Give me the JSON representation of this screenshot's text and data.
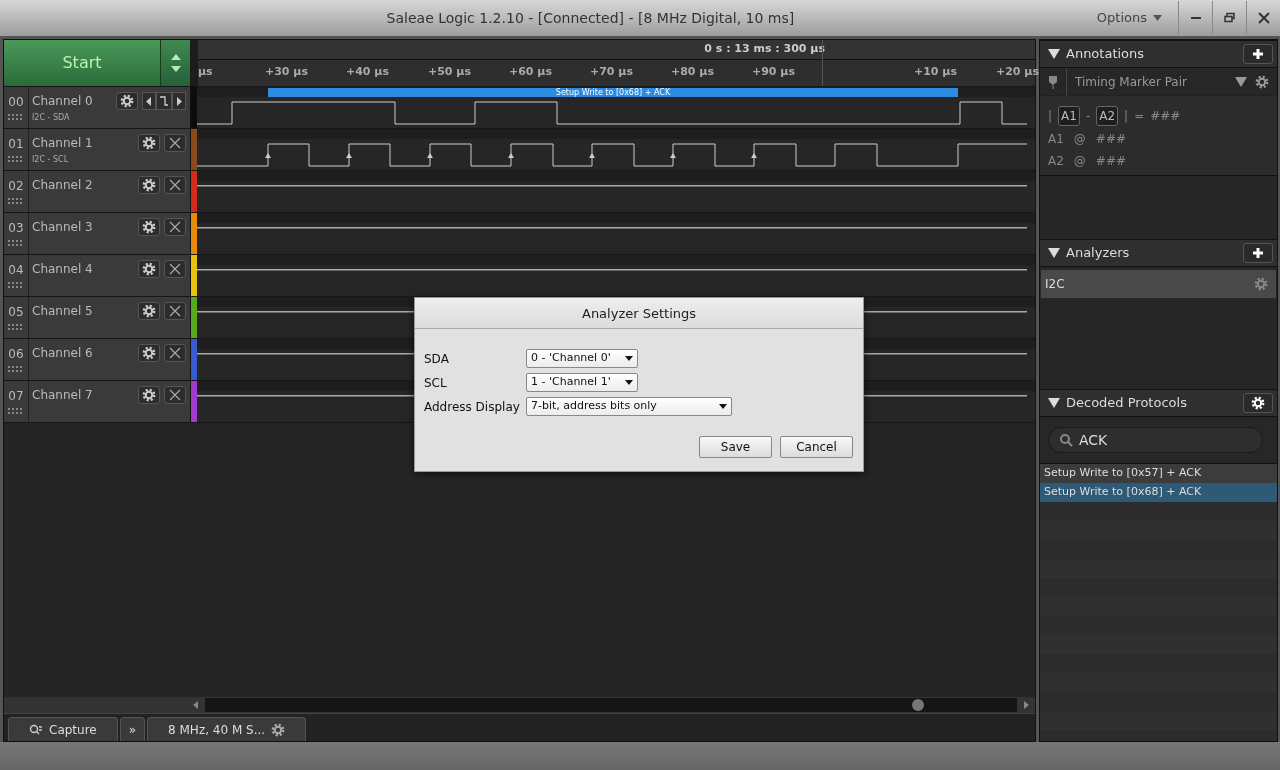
{
  "window": {
    "title": "Saleae Logic 1.2.10 - [Connected] - [8 MHz Digital, 10 ms]",
    "options_menu": "Options"
  },
  "start_button": "Start",
  "ruler": {
    "time": "0 s : 13 ms : 300 µs",
    "ticks": [
      "µs",
      "+30 µs",
      "+40 µs",
      "+50 µs",
      "+60 µs",
      "+70 µs",
      "+80 µs",
      "+90 µs",
      "+10 µs",
      "+20 µs"
    ]
  },
  "channels": [
    {
      "number": "00",
      "name": "Channel 0",
      "protocol": "I2C - SDA",
      "color": "#0c0c0c",
      "kind": "sda",
      "trigger_controls": true,
      "annotation": "Setup Write to [0x68] + ACK"
    },
    {
      "number": "01",
      "name": "Channel 1",
      "protocol": "I2C - SCL",
      "color": "#8a4a1c",
      "kind": "scl",
      "trigger_controls": false
    },
    {
      "number": "02",
      "name": "Channel 2",
      "color": "#d42a1a",
      "kind": "idle",
      "trigger_controls": false
    },
    {
      "number": "03",
      "name": "Channel 3",
      "color": "#e8890c",
      "kind": "idle",
      "trigger_controls": false
    },
    {
      "number": "04",
      "name": "Channel 4",
      "color": "#e8c20c",
      "kind": "idle",
      "trigger_controls": false
    },
    {
      "number": "05",
      "name": "Channel 5",
      "color": "#5aa81e",
      "kind": "idle",
      "trigger_controls": false
    },
    {
      "number": "06",
      "name": "Channel 6",
      "color": "#3a5ad0",
      "kind": "idle",
      "trigger_controls": false
    },
    {
      "number": "07",
      "name": "Channel 7",
      "color": "#a03ad0",
      "kind": "idle",
      "trigger_controls": false
    }
  ],
  "dialog": {
    "title": "Analyzer Settings",
    "fields": [
      {
        "label": "SDA",
        "value": "0 - 'Channel 0'",
        "kind": "short"
      },
      {
        "label": "SCL",
        "value": "1 - 'Channel 1'",
        "kind": "short"
      },
      {
        "label": "Address Display",
        "value": "7-bit, address bits only",
        "kind": "wide"
      }
    ],
    "buttons": [
      "Save",
      "Cancel"
    ]
  },
  "bottom_bar": {
    "capture_tab": "Capture",
    "expand": "»",
    "device_tab": "8 MHz, 40 M S..."
  },
  "annotations": {
    "title": "Annotations",
    "marker_type": "Timing Marker Pair",
    "measurement": [
      {
        "kind": "text",
        "text": "|"
      },
      {
        "kind": "chip",
        "text": "A1"
      },
      {
        "kind": "text",
        "text": "-"
      },
      {
        "kind": "chip",
        "text": "A2"
      },
      {
        "kind": "text",
        "text": "|"
      },
      {
        "kind": "text",
        "text": "="
      },
      {
        "kind": "text",
        "text": "###"
      }
    ],
    "markers": [
      {
        "marker": "A1",
        "at": "@",
        "value": "###"
      },
      {
        "marker": "A2",
        "at": "@",
        "value": "###"
      }
    ]
  },
  "analyzers": {
    "title": "Analyzers",
    "items": [
      {
        "name": "I2C"
      }
    ]
  },
  "decoded_protocols": {
    "title": "Decoded Protocols",
    "search": "ACK",
    "results": [
      {
        "text": "Setup Write to [0x57] + ACK",
        "selected": false
      },
      {
        "text": "Setup Write to [0x68] + ACK",
        "selected": true
      }
    ]
  }
}
